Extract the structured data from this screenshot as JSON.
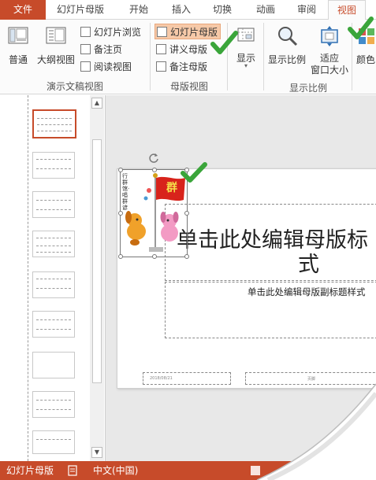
{
  "tabs": {
    "file": "文件",
    "master": "幻灯片母版",
    "home": "开始",
    "insert": "插入",
    "transitions": "切换",
    "animations": "动画",
    "review": "审阅",
    "view": "视图"
  },
  "ribbon": {
    "normal": "普通",
    "outline": "大纲视图",
    "slide_sorter": "幻灯片浏览",
    "notes_page": "备注页",
    "reading_view": "阅读视图",
    "slide_master": "幻灯片母版",
    "handout_master": "讲义母版",
    "notes_master": "备注母版",
    "show": "显示",
    "zoom": "显示比例",
    "fit_line1": "适应",
    "fit_line2": "窗口大小",
    "color": "颜色",
    "group_presentation_views": "演示文稿视图",
    "group_master_views": "母版视图",
    "group_zoom": "显示比例"
  },
  "slide": {
    "title_line1": "单击此处编辑母版标",
    "title_line2": "式",
    "subtitle": "单击此处编辑母版副标题样式",
    "footer_date": "2018/08/21",
    "footer_center": "页脚",
    "flag_text": "群",
    "banner_text": "行群馆·唱群谚"
  },
  "status": {
    "view_name": "幻灯片母版",
    "language": "中文(中国)"
  },
  "colors": {
    "accent": "#c74b2a",
    "check_green": "#3aa53a"
  },
  "icons": [
    "normal-view-icon",
    "outline-view-icon",
    "slide-sorter-icon",
    "notes-page-icon",
    "reading-view-icon",
    "slide-master-icon",
    "handout-master-icon",
    "notes-master-icon",
    "show-icon",
    "zoom-magnifier-icon",
    "fit-window-icon",
    "color-icon",
    "checkmark-icon",
    "notes-status-icon",
    "rotate-handle-icon",
    "scroll-up-icon",
    "scroll-down-icon"
  ]
}
